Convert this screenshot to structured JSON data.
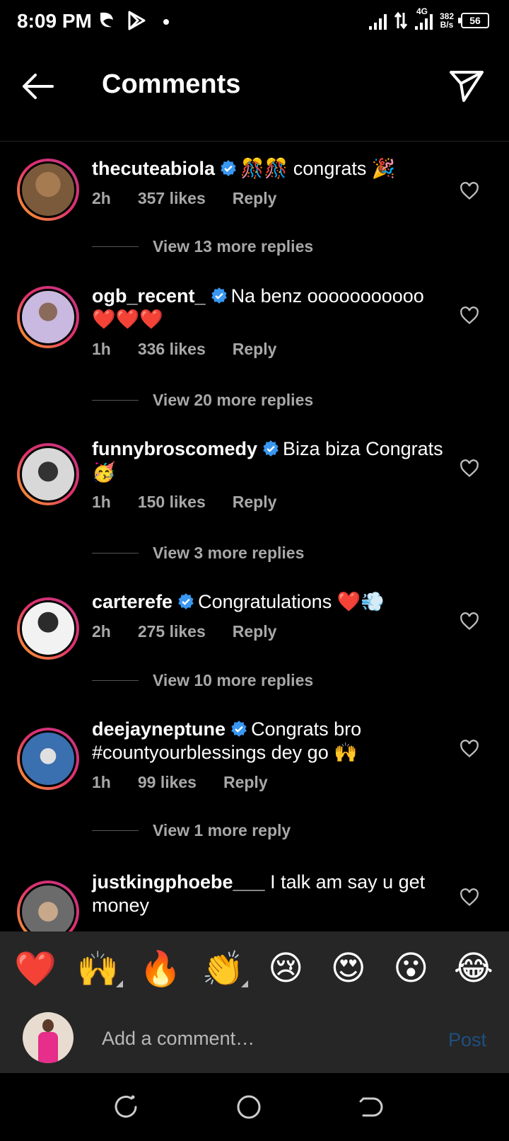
{
  "status_bar": {
    "time": "8:09 PM",
    "network_type": "4G",
    "speed_value": "382",
    "speed_unit": "B/s",
    "battery": "56"
  },
  "header": {
    "title": "Comments"
  },
  "comments": [
    {
      "username": "thecuteabiola",
      "verified": true,
      "text": "🎊🎊 congrats 🎉",
      "time": "2h",
      "likes": "357 likes",
      "reply": "Reply",
      "replies_label": "View 13 more replies",
      "avatar_color": "#7a5a3a"
    },
    {
      "username": "ogb_recent_",
      "verified": true,
      "text": "Na benz ooooooooooo ❤️❤️❤️",
      "time": "1h",
      "likes": "336 likes",
      "reply": "Reply",
      "replies_label": "View 20 more replies",
      "avatar_color": "#c9b8e0"
    },
    {
      "username": "funnybroscomedy",
      "verified": true,
      "text": "Biza biza Congrats 🥳",
      "time": "1h",
      "likes": "150 likes",
      "reply": "Reply",
      "replies_label": "View 3 more replies",
      "avatar_color": "#d8d8d8"
    },
    {
      "username": "carterefe",
      "verified": true,
      "text": "Congratulations ❤️💨",
      "time": "2h",
      "likes": "275 likes",
      "reply": "Reply",
      "replies_label": "View 10 more replies",
      "avatar_color": "#cfcfcf"
    },
    {
      "username": "deejayneptune",
      "verified": true,
      "text": "Congrats bro #countyourblessings dey go 🙌",
      "time": "1h",
      "likes": "99 likes",
      "reply": "Reply",
      "replies_label": "View 1 more reply",
      "avatar_color": "#3a6fb0"
    },
    {
      "username": "justkingphoebe___",
      "verified": false,
      "text": "I talk am say u get money",
      "time": "",
      "likes": "",
      "reply": "",
      "replies_label": "",
      "avatar_color": "#6b6b6b"
    }
  ],
  "emoji_bar": [
    "❤️",
    "🙌",
    "🔥",
    "👏",
    "😢",
    "😍",
    "😮",
    "😂"
  ],
  "composer": {
    "placeholder": "Add a comment…",
    "post_label": "Post"
  },
  "colors": {
    "background": "#000000",
    "panel": "#262626",
    "secondary_text": "#a8a8a8",
    "verified_blue": "#3897f0",
    "post_disabled": "#1d4f80"
  }
}
